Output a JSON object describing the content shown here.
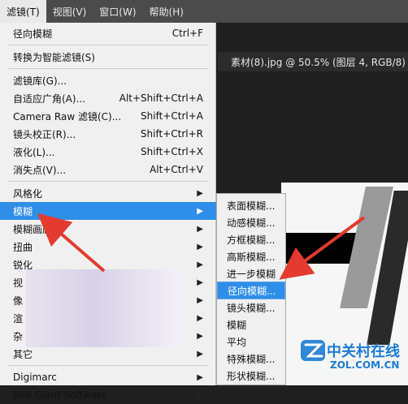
{
  "menubar": {
    "items": [
      {
        "label": "滤镜(T)",
        "active": true
      },
      {
        "label": "视图(V)",
        "active": false
      },
      {
        "label": "窗口(W)",
        "active": false
      },
      {
        "label": "帮助(H)",
        "active": false
      }
    ]
  },
  "document": {
    "title": "素材(8).jpg @ 50.5% (图层 4, RGB/8)"
  },
  "filter_menu": {
    "items": [
      {
        "type": "item",
        "label": "径向模糊",
        "shortcut": "Ctrl+F"
      },
      {
        "type": "sep"
      },
      {
        "type": "item",
        "label": "转换为智能滤镜(S)",
        "shortcut": ""
      },
      {
        "type": "sep"
      },
      {
        "type": "item",
        "label": "滤镜库(G)...",
        "shortcut": ""
      },
      {
        "type": "item",
        "label": "自适应广角(A)...",
        "shortcut": "Alt+Shift+Ctrl+A"
      },
      {
        "type": "item",
        "label": "Camera Raw 滤镜(C)...",
        "shortcut": "Shift+Ctrl+A"
      },
      {
        "type": "item",
        "label": "镜头校正(R)...",
        "shortcut": "Shift+Ctrl+R"
      },
      {
        "type": "item",
        "label": "液化(L)...",
        "shortcut": "Shift+Ctrl+X"
      },
      {
        "type": "item",
        "label": "消失点(V)...",
        "shortcut": "Alt+Ctrl+V"
      },
      {
        "type": "sep"
      },
      {
        "type": "item",
        "label": "风格化",
        "shortcut": "",
        "submenu": true
      },
      {
        "type": "item",
        "label": "模糊",
        "shortcut": "",
        "submenu": true,
        "highlight": true
      },
      {
        "type": "item",
        "label": "模糊画廊",
        "shortcut": "",
        "submenu": true
      },
      {
        "type": "item",
        "label": "扭曲",
        "shortcut": "",
        "submenu": true
      },
      {
        "type": "item",
        "label": "锐化",
        "shortcut": "",
        "submenu": true
      },
      {
        "type": "item",
        "label": "视",
        "shortcut": "",
        "submenu": true
      },
      {
        "type": "item",
        "label": "像",
        "shortcut": "",
        "submenu": true
      },
      {
        "type": "item",
        "label": "渲",
        "shortcut": "",
        "submenu": true
      },
      {
        "type": "item",
        "label": "杂",
        "shortcut": "",
        "submenu": true
      },
      {
        "type": "item",
        "label": "其它",
        "shortcut": "",
        "submenu": true
      },
      {
        "type": "sep"
      },
      {
        "type": "item",
        "label": "Digimarc",
        "shortcut": "",
        "submenu": true
      },
      {
        "type": "item",
        "label": "Red Giant Software",
        "shortcut": "",
        "submenu": true
      }
    ]
  },
  "blur_submenu": {
    "items": [
      {
        "label": "表面模糊..."
      },
      {
        "label": "动感模糊..."
      },
      {
        "label": "方框模糊..."
      },
      {
        "label": "高斯模糊..."
      },
      {
        "label": "进一步模糊"
      },
      {
        "label": "径向模糊...",
        "highlight": true
      },
      {
        "label": "镜头模糊..."
      },
      {
        "label": "模糊"
      },
      {
        "label": "平均"
      },
      {
        "label": "特殊模糊..."
      },
      {
        "label": "形状模糊..."
      }
    ]
  },
  "watermark": {
    "cn": "中关村在线",
    "en": "ZOL.COM.CN"
  },
  "colors": {
    "highlight": "#2f8ee8",
    "arrow": "#e33b2f",
    "menubar": "#4b4b4b"
  }
}
